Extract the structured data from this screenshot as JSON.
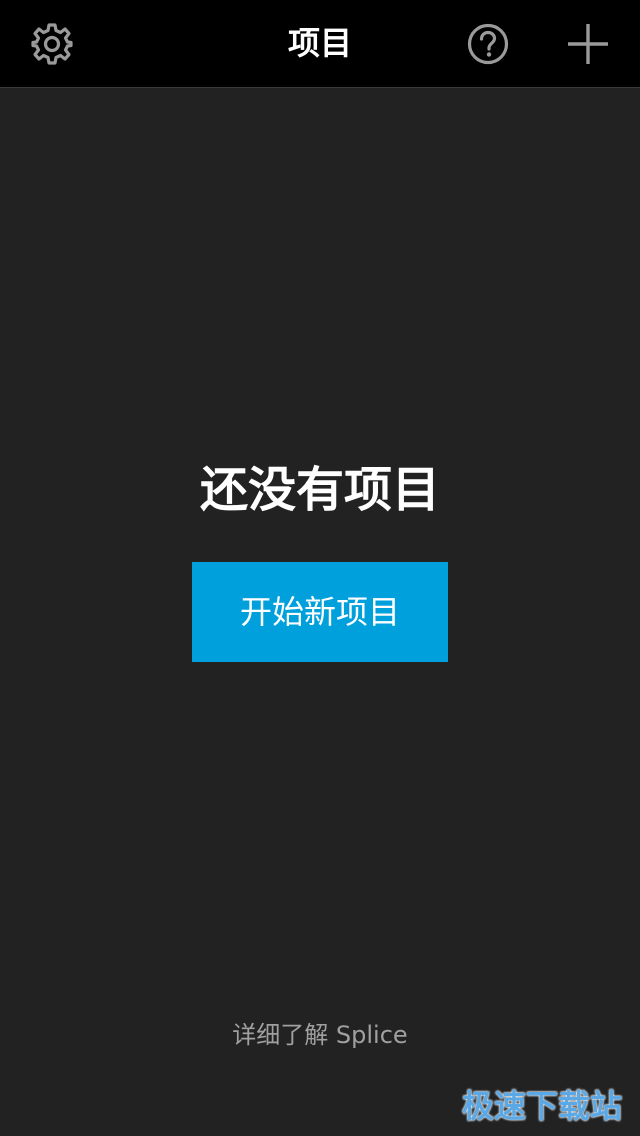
{
  "header": {
    "title": "项目",
    "settings_icon": "gear-icon",
    "help_icon": "help-circle-icon",
    "add_icon": "plus-icon"
  },
  "main": {
    "empty_title": "还没有项目",
    "start_button_label": "开始新项目",
    "learn_more_link": "详细了解 Splice"
  },
  "watermark": "极速下载站",
  "colors": {
    "background": "#222222",
    "topbar": "#000000",
    "accent": "#00a0dc",
    "icon": "#9a9a9a",
    "secondary_text": "#a0a0a0"
  }
}
